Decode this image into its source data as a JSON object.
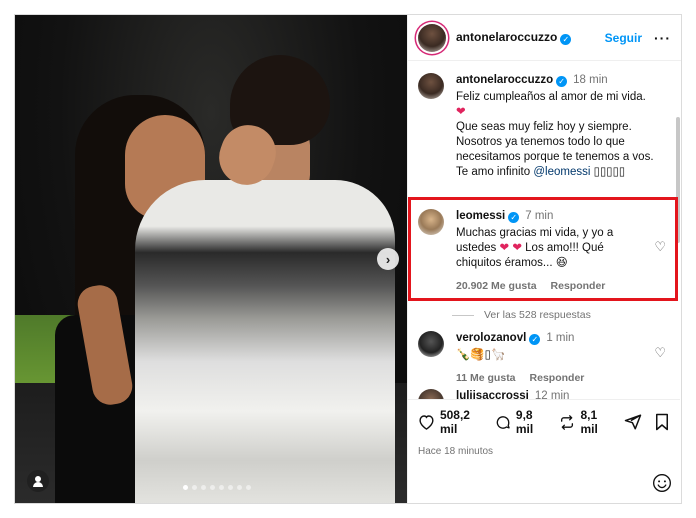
{
  "post": {
    "author": "antonelaroccuzzo",
    "follow_label": "Seguir",
    "more_label": "···",
    "verified_mark": "✓",
    "next_arrow": "›",
    "carousel_dots": 8,
    "carousel_active": 1
  },
  "caption": {
    "author": "antonelaroccuzzo",
    "time": "18 min",
    "line1": "Feliz cumpleaños al amor de mi vida.",
    "heart": "❤",
    "line2": "Que seas muy feliz hoy y siempre. Nosotros ya tenemos todo lo que necesitamos porque te tenemos a vos.",
    "line3_prefix": "Te amo infinito ",
    "mention": "@leomessi",
    "line3_suffix": " ▯▯▯▯▯"
  },
  "comments": [
    {
      "author": "leomessi",
      "time": "7 min",
      "text_a": "Muchas gracias mi vida, y yo a ustedes ",
      "hearts": "❤ ❤",
      "text_b": " Los amo!!! Qué chiquitos éramos... 😆",
      "likes": "20.902 Me gusta",
      "reply_label": "Responder",
      "view_replies": "Ver las 528 respuestas"
    },
    {
      "author": "verolozanovl",
      "time": "1 min",
      "text": "🍾🥞▯🦙",
      "likes": "11 Me gusta",
      "reply_label": "Responder"
    },
    {
      "author": "luliisaccrossi",
      "time": "12 min"
    }
  ],
  "actions": {
    "likes": "508,2 mil",
    "comments": "9,8 mil",
    "reposts": "8,1 mil",
    "time_ago": "Hace 18 minutos"
  },
  "colors": {
    "accent": "#0095f6",
    "highlight_border": "#e3151d",
    "heart": "#e0245e"
  }
}
